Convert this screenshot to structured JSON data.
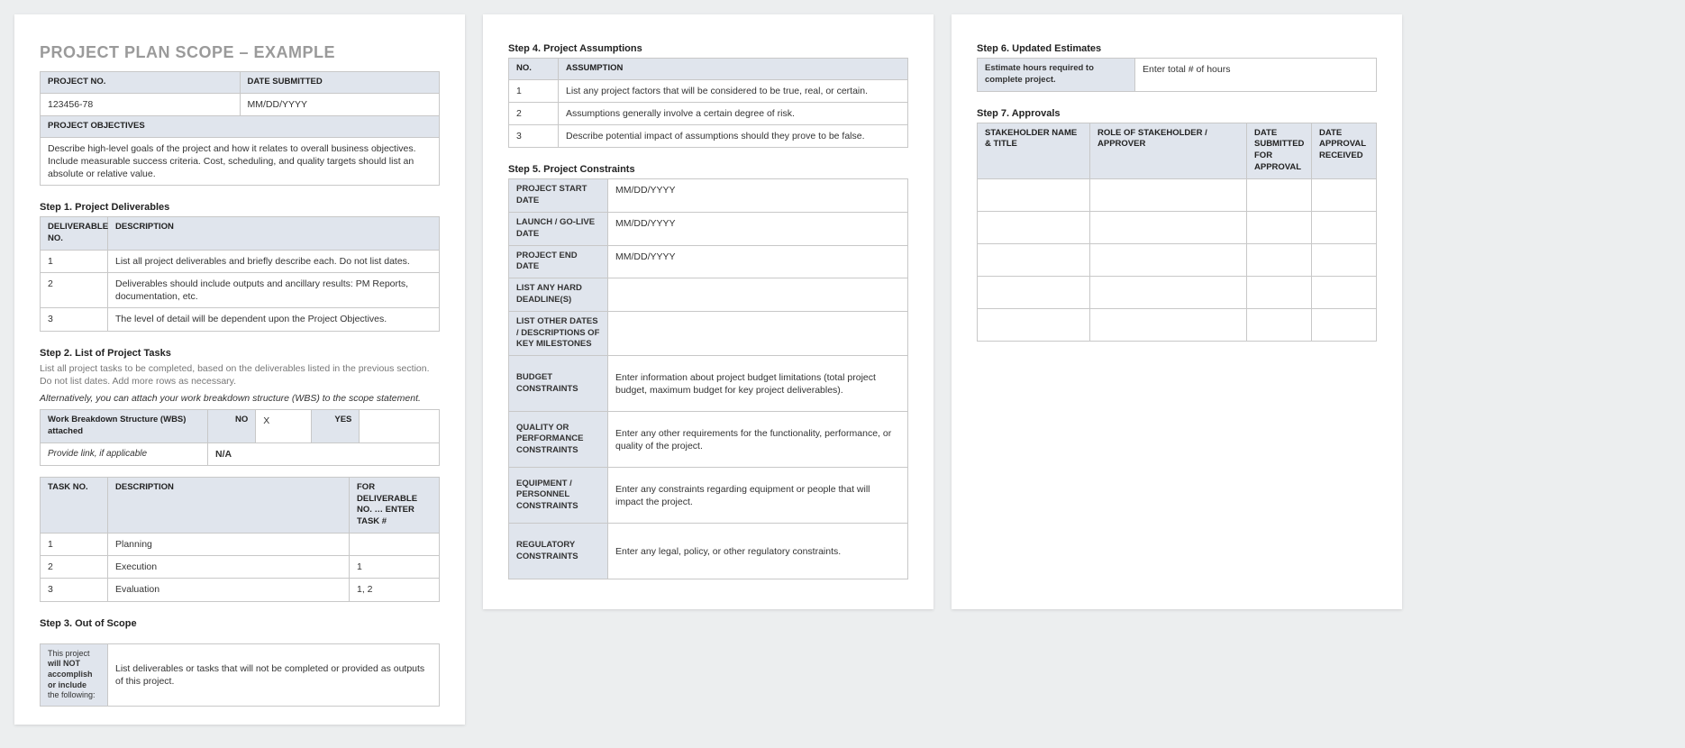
{
  "doc": {
    "title": "PROJECT PLAN SCOPE – EXAMPLE"
  },
  "info": {
    "projectNoLabel": "PROJECT NO.",
    "projectNo": "123456-78",
    "dateSubmittedLabel": "DATE SUBMITTED",
    "dateSubmitted": "MM/DD/YYYY",
    "objectivesLabel": "PROJECT OBJECTIVES",
    "objectives": "Describe high-level goals of the project and how it relates to overall business objectives.  Include measurable success criteria.  Cost, scheduling, and quality targets should list an absolute or relative value."
  },
  "step1": {
    "heading": "Step 1. Project Deliverables",
    "colNo": "DELIVERABLE NO.",
    "colDesc": "DESCRIPTION",
    "rows": [
      {
        "no": "1",
        "desc": "List all project deliverables and briefly describe each. Do not list dates."
      },
      {
        "no": "2",
        "desc": "Deliverables should include outputs and ancillary results: PM Reports, documentation, etc."
      },
      {
        "no": "3",
        "desc": "The level of detail will be dependent upon the Project Objectives."
      }
    ]
  },
  "step2": {
    "heading": "Step 2. List of Project Tasks",
    "sub": "List all project tasks to be completed, based on the deliverables listed in the previous section. Do not list dates. Add more rows as necessary.",
    "subItalic": "Alternatively, you can attach your work breakdown structure (WBS) to the scope statement.",
    "wbsLabel": "Work Breakdown Structure (WBS) attached",
    "noLabel": "NO",
    "noVal": "X",
    "yesLabel": "YES",
    "yesVal": "",
    "linkLabel": "Provide link, if applicable",
    "linkVal": "N/A",
    "colTaskNo": "TASK NO.",
    "colDesc": "DESCRIPTION",
    "colFor": "FOR DELIVERABLE NO. … ENTER TASK #",
    "rows": [
      {
        "no": "1",
        "desc": "Planning",
        "for": ""
      },
      {
        "no": "2",
        "desc": "Execution",
        "for": "1"
      },
      {
        "no": "3",
        "desc": "Evaluation",
        "for": "1, 2"
      }
    ]
  },
  "step3": {
    "heading": "Step 3. Out of Scope",
    "label": "This project will NOT accomplish or include the following:",
    "labelPlain1": "This project ",
    "labelBold": "will NOT accomplish or include",
    "labelPlain2": " the following:",
    "value": "List deliverables or tasks that will not be completed or provided as outputs of this project."
  },
  "step4": {
    "heading": "Step 4. Project Assumptions",
    "colNo": "NO.",
    "colAssumption": "ASSUMPTION",
    "rows": [
      {
        "no": "1",
        "desc": "List any project factors that will be considered to be true, real, or certain."
      },
      {
        "no": "2",
        "desc": "Assumptions generally involve a certain degree of risk."
      },
      {
        "no": "3",
        "desc": "Describe potential impact of assumptions should they prove to be false."
      }
    ]
  },
  "step5": {
    "heading": "Step 5. Project Constraints",
    "startLabel": "PROJECT START DATE",
    "startVal": "MM/DD/YYYY",
    "launchLabel": "LAUNCH / GO-LIVE DATE",
    "launchVal": "MM/DD/YYYY",
    "endLabel": "PROJECT END DATE",
    "endVal": "MM/DD/YYYY",
    "hardLabel": "LIST ANY HARD DEADLINE(S)",
    "hardVal": "",
    "otherLabel": "LIST OTHER DATES / DESCRIPTIONS OF KEY MILESTONES",
    "otherVal": "",
    "budgetLabel": "BUDGET CONSTRAINTS",
    "budgetVal": "Enter information about project budget limitations (total project budget, maximum budget for key project deliverables).",
    "qualityLabel": "QUALITY OR PERFORMANCE CONSTRAINTS",
    "qualityVal": "Enter any other requirements for the functionality, performance, or quality of the project.",
    "equipLabel": "EQUIPMENT / PERSONNEL CONSTRAINTS",
    "equipVal": "Enter any constraints regarding equipment or people that will impact the project.",
    "regLabel": "REGULATORY CONSTRAINTS",
    "regVal": "Enter any legal, policy, or other regulatory constraints."
  },
  "step6": {
    "heading": "Step 6. Updated Estimates",
    "label": "Estimate hours required to complete project.",
    "value": "Enter total # of hours"
  },
  "step7": {
    "heading": "Step 7. Approvals",
    "colName": "STAKEHOLDER NAME & TITLE",
    "colRole": "ROLE OF STAKEHOLDER / APPROVER",
    "colSubmitted": "DATE SUBMITTED FOR APPROVAL",
    "colReceived": "DATE APPROVAL RECEIVED"
  }
}
